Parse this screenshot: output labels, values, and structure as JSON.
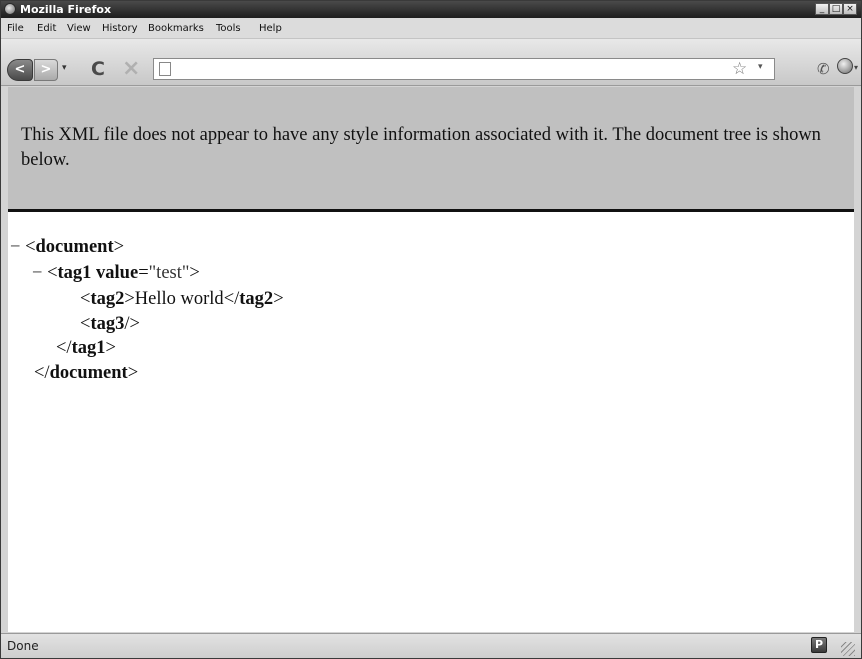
{
  "window": {
    "title": "Mozilla Firefox",
    "controls": [
      "_",
      "□",
      "×"
    ]
  },
  "menubar": {
    "items": [
      "File",
      "Edit",
      "View",
      "History",
      "Bookmarks",
      "Tools",
      "Help"
    ]
  },
  "toolbar": {
    "back_glyph": "<",
    "forward_glyph": ">",
    "dropdown_glyph": "▾",
    "reload_glyph": "C",
    "stop_glyph": "×",
    "url_value": "",
    "star_glyph": "☆",
    "addon_glyph": "✆"
  },
  "content": {
    "notice": "This XML file does not appear to have any style information associated with it. The document tree is shown below.",
    "tree": {
      "collapse_glyph": "−",
      "document_open": "document",
      "tag1_name": "tag1",
      "tag1_attr_name": "value",
      "tag1_attr_value": "\"test\"",
      "tag2_name": "tag2",
      "tag2_text": "Hello world",
      "tag3_name": "tag3",
      "tag1_close": "tag1",
      "document_close": "document"
    }
  },
  "statusbar": {
    "status": "Done",
    "p_label": "P"
  }
}
